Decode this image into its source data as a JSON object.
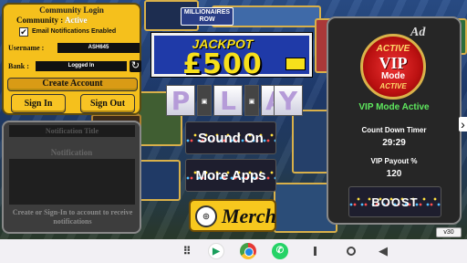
{
  "background": {
    "tile_label": "MILLIONAIRES ROW"
  },
  "login": {
    "title": "Community Login",
    "community_label": "Community :",
    "community_status": "Active",
    "email_checkbox": "✔",
    "email_label": "Email Notifications Enabled",
    "username_label": "Username :",
    "username_value": "ASH645",
    "bank_label": "Bank :",
    "bank_value": "Logged In",
    "sync_icon": "↻",
    "create_label": "Create Account",
    "signin_label": "Sign In",
    "signout_label": "Sign Out"
  },
  "notifications": {
    "title_field": "Notification Title",
    "heading": "Notification",
    "message": "Create or Sign-In to account to receive notifications"
  },
  "jackpot": {
    "label": "JACKPOT",
    "amount": "£500"
  },
  "play": {
    "letters": [
      "P",
      "L",
      "A",
      "Y"
    ]
  },
  "buttons": {
    "sound": "Sound On",
    "more_apps": "More Apps",
    "merch": "Merch"
  },
  "vip": {
    "ad_label": "Ad",
    "badge_top": "ACTIVE",
    "badge_vip": "VIP",
    "badge_mode": "Mode",
    "badge_bottom": "ACTIVE",
    "mode_status": "VIP Mode Active",
    "countdown_label": "Count Down Timer",
    "countdown_value": "29:29",
    "payout_label": "VIP Payout %",
    "payout_value": "120",
    "boost_label": "BOOST"
  },
  "version": "v30",
  "taskbar": {
    "apps_icon": "⠿",
    "playstore_icon": "▶",
    "whatsapp_icon": "✆",
    "back_icon": "◀"
  }
}
